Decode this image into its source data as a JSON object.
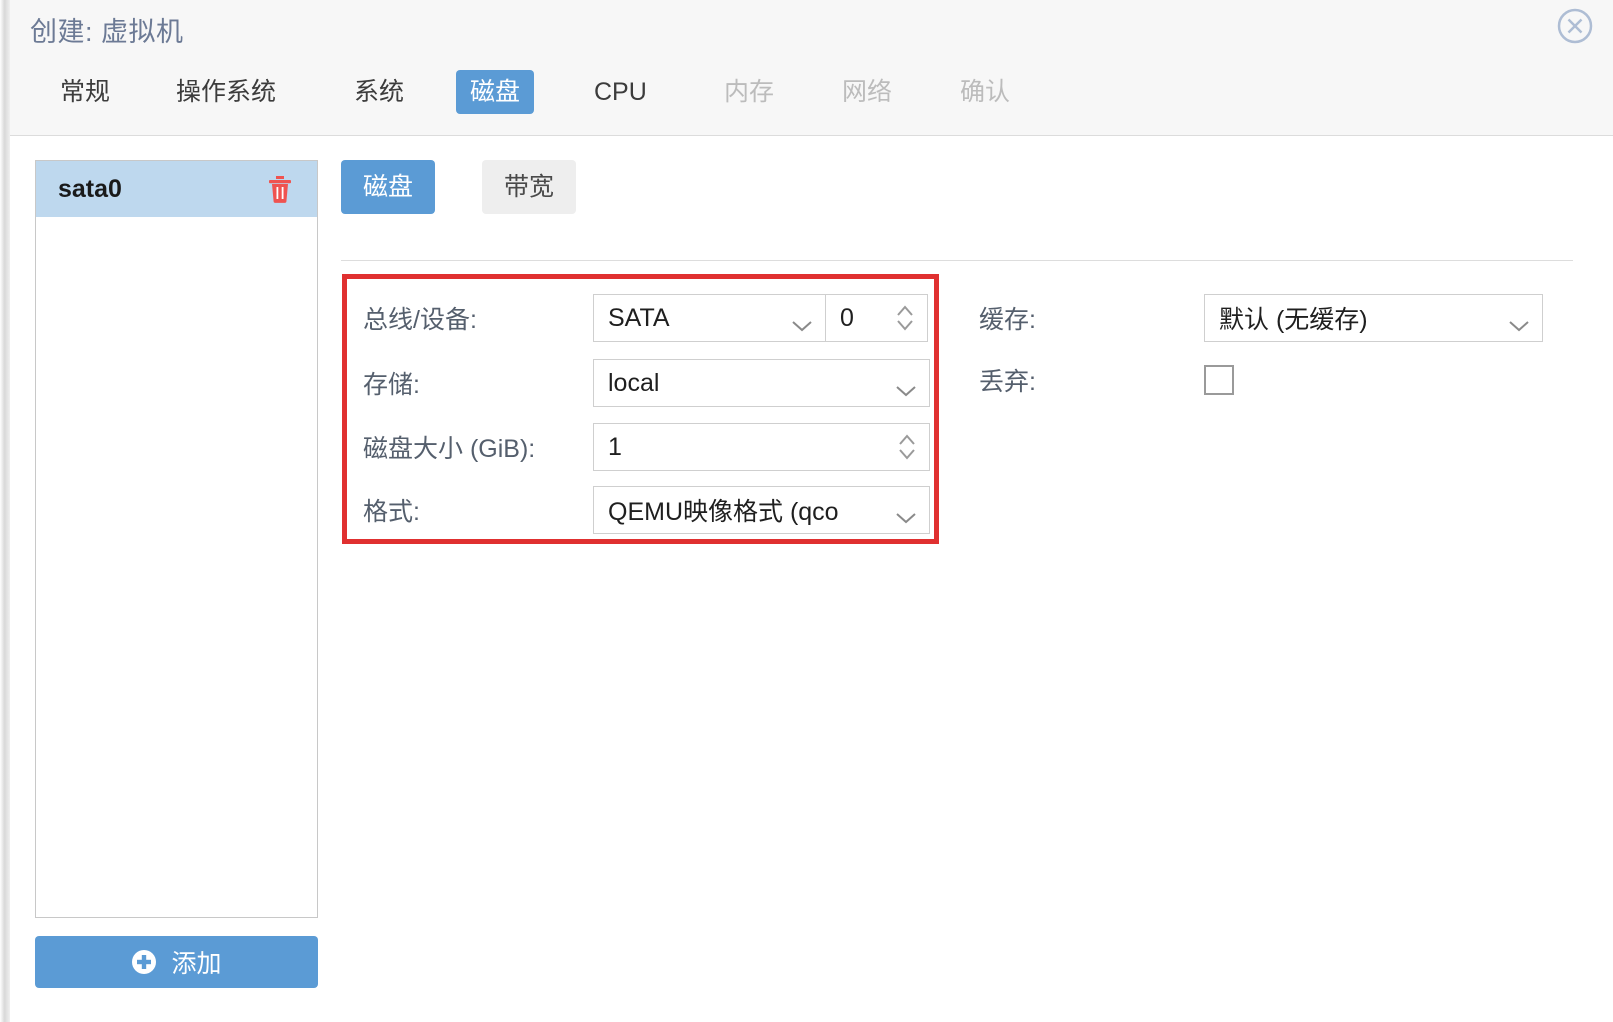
{
  "header": {
    "title": "创建: 虚拟机",
    "close_icon": "close-circle-icon"
  },
  "tabs": [
    {
      "label": "常规",
      "state": "normal"
    },
    {
      "label": "操作系统",
      "state": "normal"
    },
    {
      "label": "系统",
      "state": "normal"
    },
    {
      "label": "磁盘",
      "state": "active"
    },
    {
      "label": "CPU",
      "state": "normal"
    },
    {
      "label": "内存",
      "state": "disabled"
    },
    {
      "label": "网络",
      "state": "disabled"
    },
    {
      "label": "确认",
      "state": "disabled"
    }
  ],
  "sidebar": {
    "devices": [
      {
        "name": "sata0",
        "delete_icon": "trash-icon"
      }
    ],
    "add_button": {
      "label": "添加",
      "icon": "plus-circle-icon"
    }
  },
  "subtabs": [
    {
      "label": "磁盘",
      "state": "active"
    },
    {
      "label": "带宽",
      "state": "inactive"
    }
  ],
  "form": {
    "left": {
      "bus_device": {
        "label": "总线/设备:",
        "bus_value": "SATA",
        "device_value": "0"
      },
      "storage": {
        "label": "存储:",
        "value": "local"
      },
      "disk_size": {
        "label": "磁盘大小 (GiB):",
        "value": "1"
      },
      "format": {
        "label": "格式:",
        "value": "QEMU映像格式 (qco"
      }
    },
    "right": {
      "cache": {
        "label": "缓存:",
        "value": "默认 (无缓存)"
      },
      "discard": {
        "label": "丢弃:",
        "checked": false
      }
    }
  },
  "colors": {
    "accent": "#5b9bd5",
    "highlight_border": "#e03030",
    "selected_row": "#bed8ee",
    "label_text": "#555f6d",
    "title_text": "#6c7a95"
  }
}
